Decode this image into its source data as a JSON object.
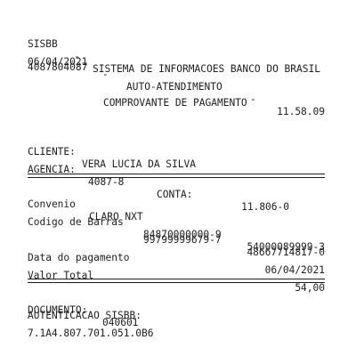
{
  "header": {
    "system": "SISBB",
    "dash1": "-",
    "system_name": "SISTEMA DE INFORMACOES BANCO DO BRASIL",
    "date": "06/04/2021",
    "dash2": "-",
    "mode": "AUTO-ATENDIMENTO",
    "dash3": "-",
    "time": "11.58.09",
    "terminal": "4087804087"
  },
  "title": "COMPROVANTE DE PAGAMENTO",
  "client": {
    "label": "CLIENTE:",
    "name": "VERA LUCIA DA SILVA",
    "agency_label": "AGENCIA:",
    "agency": "4087-8",
    "account_label": "CONTA:",
    "account": "11.806-0"
  },
  "payment": {
    "convenio_label": "Convenio",
    "convenio": "CLARO NXT",
    "barcode_label": "Codigo de Barras",
    "barcode": [
      "84870000000-9",
      "54000089999-3",
      "99799999679-7",
      "48667714817-0"
    ],
    "date_label": "Data do pagamento",
    "date": "06/04/2021",
    "total_label": "Valor Total",
    "total": "54,00"
  },
  "footer": {
    "document_label": "DOCUMENTO:",
    "document": "040601",
    "auth_label": "AUTENTICACAO SISBB:",
    "auth": "7.1A4.807.701.051.0B6"
  }
}
